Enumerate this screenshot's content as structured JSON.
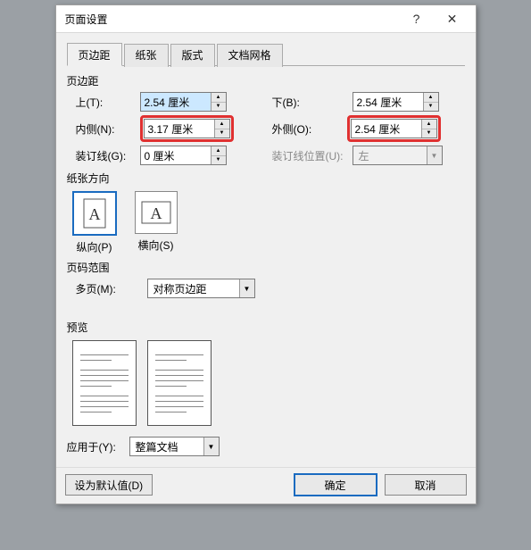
{
  "title": "页面设置",
  "tabs": [
    "页边距",
    "纸张",
    "版式",
    "文档网格"
  ],
  "activeTab": 0,
  "margins": {
    "section": "页边距",
    "topLabel": "上(T):",
    "topValue": "2.54 厘米",
    "bottomLabel": "下(B):",
    "bottomValue": "2.54 厘米",
    "insideLabel": "内侧(N):",
    "insideValue": "3.17 厘米",
    "outsideLabel": "外侧(O):",
    "outsideValue": "2.54 厘米",
    "gutterLabel": "装订线(G):",
    "gutterValue": "0 厘米",
    "gutterPosLabel": "装订线位置(U):",
    "gutterPosValue": "左"
  },
  "orientation": {
    "section": "纸张方向",
    "portrait": "纵向(P)",
    "landscape": "横向(S)"
  },
  "pages": {
    "section": "页码范围",
    "multiLabel": "多页(M):",
    "multiValue": "对称页边距"
  },
  "preview": {
    "section": "预览"
  },
  "applyTo": {
    "label": "应用于(Y):",
    "value": "整篇文档"
  },
  "buttons": {
    "default": "设为默认值(D)",
    "ok": "确定",
    "cancel": "取消"
  }
}
